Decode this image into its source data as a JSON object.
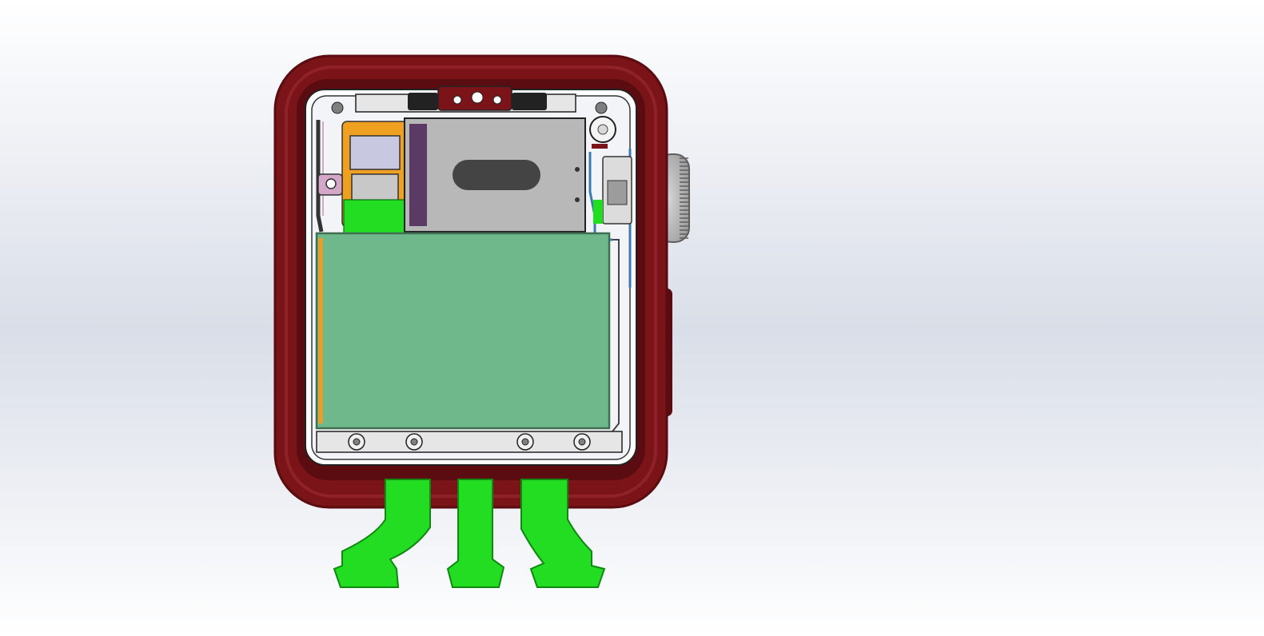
{
  "viewport": {
    "background_top": "#ffffff",
    "background_mid": "#d9dee8",
    "background_bottom": "#ffffff"
  },
  "model": {
    "colors": {
      "case": "#7a1418",
      "case_dark": "#5a0c10",
      "case_light": "#8e2228",
      "battery": "#6fb88c",
      "battery_edge": "#3f6e50",
      "flex_cable": "#22dd22",
      "flex_edge": "#118811",
      "taptic_engine": "#b8b8b8",
      "taptic_dark": "#444444",
      "bracket_orange": "#f0a020",
      "chip_lavender": "#c8c8e0",
      "chip_gray": "#c8c8c8",
      "pink_part": "#d4a6c8",
      "crown": "#9c9c9c",
      "crown_dark": "#5e5e5e",
      "blue_wire": "#3b7bb0",
      "screw": "#7f7f7f"
    },
    "parts": {
      "flex_cable_count": 3,
      "bottom_screw_count": 4
    }
  }
}
